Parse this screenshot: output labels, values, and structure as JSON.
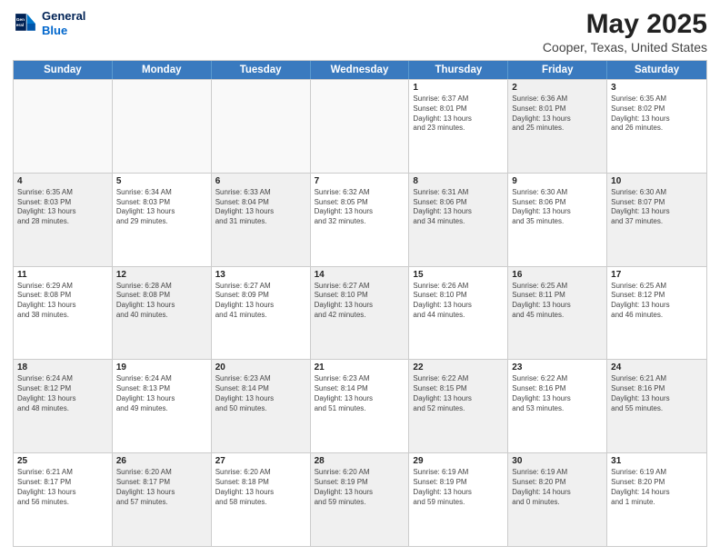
{
  "header": {
    "logo_line1": "General",
    "logo_line2": "Blue",
    "title": "May 2025",
    "subtitle": "Cooper, Texas, United States"
  },
  "calendar": {
    "days_of_week": [
      "Sunday",
      "Monday",
      "Tuesday",
      "Wednesday",
      "Thursday",
      "Friday",
      "Saturday"
    ],
    "weeks": [
      [
        {
          "day": "",
          "info": "",
          "empty": true
        },
        {
          "day": "",
          "info": "",
          "empty": true
        },
        {
          "day": "",
          "info": "",
          "empty": true
        },
        {
          "day": "",
          "info": "",
          "empty": true
        },
        {
          "day": "1",
          "info": "Sunrise: 6:37 AM\nSunset: 8:01 PM\nDaylight: 13 hours\nand 23 minutes."
        },
        {
          "day": "2",
          "info": "Sunrise: 6:36 AM\nSunset: 8:01 PM\nDaylight: 13 hours\nand 25 minutes.",
          "shaded": true
        },
        {
          "day": "3",
          "info": "Sunrise: 6:35 AM\nSunset: 8:02 PM\nDaylight: 13 hours\nand 26 minutes."
        }
      ],
      [
        {
          "day": "4",
          "info": "Sunrise: 6:35 AM\nSunset: 8:03 PM\nDaylight: 13 hours\nand 28 minutes.",
          "shaded": true
        },
        {
          "day": "5",
          "info": "Sunrise: 6:34 AM\nSunset: 8:03 PM\nDaylight: 13 hours\nand 29 minutes."
        },
        {
          "day": "6",
          "info": "Sunrise: 6:33 AM\nSunset: 8:04 PM\nDaylight: 13 hours\nand 31 minutes.",
          "shaded": true
        },
        {
          "day": "7",
          "info": "Sunrise: 6:32 AM\nSunset: 8:05 PM\nDaylight: 13 hours\nand 32 minutes."
        },
        {
          "day": "8",
          "info": "Sunrise: 6:31 AM\nSunset: 8:06 PM\nDaylight: 13 hours\nand 34 minutes.",
          "shaded": true
        },
        {
          "day": "9",
          "info": "Sunrise: 6:30 AM\nSunset: 8:06 PM\nDaylight: 13 hours\nand 35 minutes."
        },
        {
          "day": "10",
          "info": "Sunrise: 6:30 AM\nSunset: 8:07 PM\nDaylight: 13 hours\nand 37 minutes.",
          "shaded": true
        }
      ],
      [
        {
          "day": "11",
          "info": "Sunrise: 6:29 AM\nSunset: 8:08 PM\nDaylight: 13 hours\nand 38 minutes."
        },
        {
          "day": "12",
          "info": "Sunrise: 6:28 AM\nSunset: 8:08 PM\nDaylight: 13 hours\nand 40 minutes.",
          "shaded": true
        },
        {
          "day": "13",
          "info": "Sunrise: 6:27 AM\nSunset: 8:09 PM\nDaylight: 13 hours\nand 41 minutes."
        },
        {
          "day": "14",
          "info": "Sunrise: 6:27 AM\nSunset: 8:10 PM\nDaylight: 13 hours\nand 42 minutes.",
          "shaded": true
        },
        {
          "day": "15",
          "info": "Sunrise: 6:26 AM\nSunset: 8:10 PM\nDaylight: 13 hours\nand 44 minutes."
        },
        {
          "day": "16",
          "info": "Sunrise: 6:25 AM\nSunset: 8:11 PM\nDaylight: 13 hours\nand 45 minutes.",
          "shaded": true
        },
        {
          "day": "17",
          "info": "Sunrise: 6:25 AM\nSunset: 8:12 PM\nDaylight: 13 hours\nand 46 minutes."
        }
      ],
      [
        {
          "day": "18",
          "info": "Sunrise: 6:24 AM\nSunset: 8:12 PM\nDaylight: 13 hours\nand 48 minutes.",
          "shaded": true
        },
        {
          "day": "19",
          "info": "Sunrise: 6:24 AM\nSunset: 8:13 PM\nDaylight: 13 hours\nand 49 minutes."
        },
        {
          "day": "20",
          "info": "Sunrise: 6:23 AM\nSunset: 8:14 PM\nDaylight: 13 hours\nand 50 minutes.",
          "shaded": true
        },
        {
          "day": "21",
          "info": "Sunrise: 6:23 AM\nSunset: 8:14 PM\nDaylight: 13 hours\nand 51 minutes."
        },
        {
          "day": "22",
          "info": "Sunrise: 6:22 AM\nSunset: 8:15 PM\nDaylight: 13 hours\nand 52 minutes.",
          "shaded": true
        },
        {
          "day": "23",
          "info": "Sunrise: 6:22 AM\nSunset: 8:16 PM\nDaylight: 13 hours\nand 53 minutes."
        },
        {
          "day": "24",
          "info": "Sunrise: 6:21 AM\nSunset: 8:16 PM\nDaylight: 13 hours\nand 55 minutes.",
          "shaded": true
        }
      ],
      [
        {
          "day": "25",
          "info": "Sunrise: 6:21 AM\nSunset: 8:17 PM\nDaylight: 13 hours\nand 56 minutes."
        },
        {
          "day": "26",
          "info": "Sunrise: 6:20 AM\nSunset: 8:17 PM\nDaylight: 13 hours\nand 57 minutes.",
          "shaded": true
        },
        {
          "day": "27",
          "info": "Sunrise: 6:20 AM\nSunset: 8:18 PM\nDaylight: 13 hours\nand 58 minutes."
        },
        {
          "day": "28",
          "info": "Sunrise: 6:20 AM\nSunset: 8:19 PM\nDaylight: 13 hours\nand 59 minutes.",
          "shaded": true
        },
        {
          "day": "29",
          "info": "Sunrise: 6:19 AM\nSunset: 8:19 PM\nDaylight: 13 hours\nand 59 minutes."
        },
        {
          "day": "30",
          "info": "Sunrise: 6:19 AM\nSunset: 8:20 PM\nDaylight: 14 hours\nand 0 minutes.",
          "shaded": true
        },
        {
          "day": "31",
          "info": "Sunrise: 6:19 AM\nSunset: 8:20 PM\nDaylight: 14 hours\nand 1 minute."
        }
      ]
    ]
  }
}
